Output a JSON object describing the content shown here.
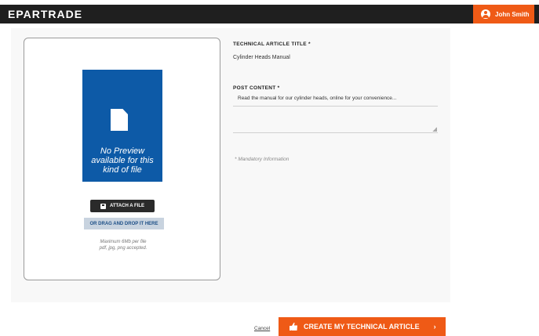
{
  "header": {
    "brand": "EPARTRADE",
    "user_name": "John Smith"
  },
  "upload": {
    "preview_text": "No Preview available for this kind of file",
    "attach_label": "ATTACH A FILE",
    "drag_label": "OR DRAG AND DROP IT HERE",
    "hint_line1": "Maximum 6Mb per file",
    "hint_line2": "pdf, jpg, png accepted."
  },
  "form": {
    "title_label": "TECHNICAL ARTICLE TITLE *",
    "title_value": "Cylinder Heads Manual",
    "content_label": "POST CONTENT *",
    "content_value": "Read the manual for our cylinder heads, online for your convenience...",
    "mandatory_note": "* Mandatory Information"
  },
  "actions": {
    "cancel_label": "Cancel",
    "create_label": "CREATE MY TECHNICAL ARTICLE",
    "create_chevron": "›"
  },
  "colors": {
    "accent": "#ef5a16",
    "preview_blue": "#0d5aa7",
    "topbar": "#1f1f1f"
  },
  "icons": [
    "user-icon",
    "file-icon",
    "save-icon",
    "thumb-up-icon",
    "chevron-right-icon"
  ]
}
